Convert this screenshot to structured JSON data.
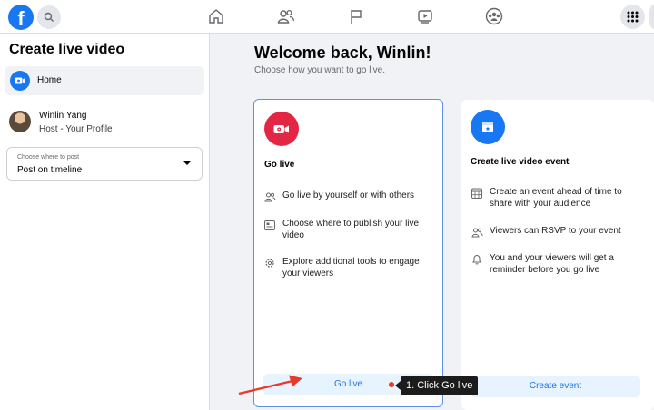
{
  "topbar": {
    "logo": "facebook-f-logo",
    "nav_icons": [
      "home-icon",
      "friends-icon",
      "flag-icon",
      "watch-icon",
      "groups-icon"
    ]
  },
  "sidebar": {
    "title": "Create live video",
    "home_label": "Home",
    "profile": {
      "name": "Winlin Yang",
      "subtitle": "Host - Your Profile"
    },
    "post_select": {
      "label": "Choose where to post",
      "value": "Post on timeline"
    }
  },
  "main": {
    "welcome": "Welcome back, Winlin!",
    "subtitle": "Choose how you want to go live.",
    "go_live_card": {
      "title": "Go live",
      "features": [
        "Go live by yourself or with others",
        "Choose where to publish your live video",
        "Explore additional tools to engage your viewers"
      ],
      "button": "Go live"
    },
    "event_card": {
      "title": "Create live video event",
      "features": [
        "Create an event ahead of time to share with your audience",
        "Viewers can RSVP to your event",
        "You and your viewers will get a reminder before you go live"
      ],
      "button": "Create event"
    }
  },
  "annotation": {
    "tooltip": "1. Click Go live"
  },
  "colors": {
    "brand": "#1877f2",
    "golive_red": "#e42645",
    "button_bg": "#e7f3ff",
    "annotation_red": "#e8392b"
  }
}
